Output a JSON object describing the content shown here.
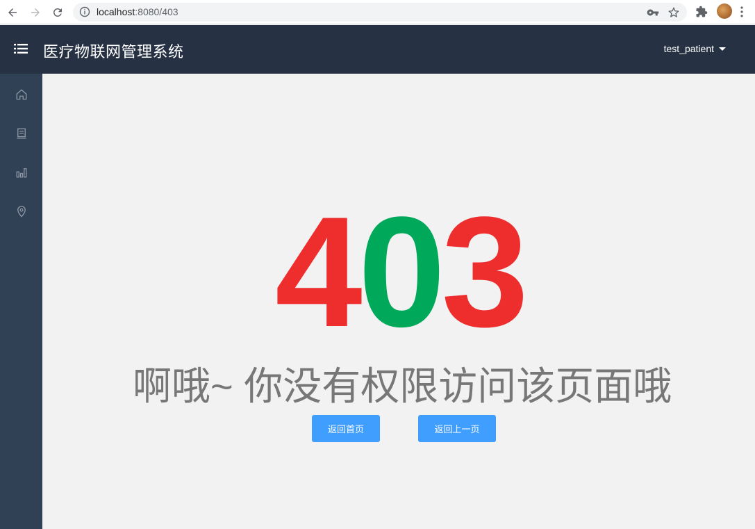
{
  "browser": {
    "url_host": "localhost",
    "url_path": ":8080/403"
  },
  "header": {
    "title": "医疗物联网管理系统",
    "user": "test_patient"
  },
  "sidebar": {
    "items": [
      {
        "icon": "home-icon"
      },
      {
        "icon": "document-icon"
      },
      {
        "icon": "bar-chart-icon"
      },
      {
        "icon": "location-icon"
      }
    ]
  },
  "error": {
    "digit1": "4",
    "digit2": "0",
    "digit3": "3",
    "message": "啊哦~ 你没有权限访问该页面哦",
    "home_button": "返回首页",
    "back_button": "返回上一页"
  },
  "colors": {
    "header_bg": "#263244",
    "sidebar_bg": "#304156",
    "digit_red": "#ee2d2d",
    "digit_green": "#00a859",
    "button_blue": "#409eff"
  }
}
